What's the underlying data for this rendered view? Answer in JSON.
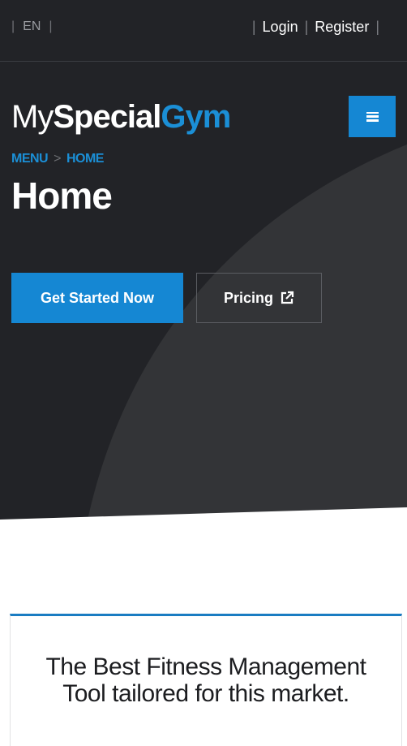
{
  "topbar": {
    "language": "EN",
    "login_label": "Login",
    "register_label": "Register"
  },
  "brand": {
    "part1": "My",
    "part2": "Special",
    "part3": "Gym",
    "accent_color": "#1587d3"
  },
  "menu_button": {
    "icon": "hamburger-icon"
  },
  "breadcrumb": {
    "items": [
      "MENU",
      "HOME"
    ],
    "separator": ">"
  },
  "page_title": "Home",
  "cta": {
    "primary_label": "Get Started Now",
    "secondary_label": "Pricing",
    "secondary_icon": "external-link-icon"
  },
  "feature_card": {
    "title": "The Best Fitness Management Tool tailored for this market."
  },
  "colors": {
    "hero_bg": "#222327",
    "hero_curve": "#333437",
    "card_border_accent": "#1a7cc2"
  }
}
